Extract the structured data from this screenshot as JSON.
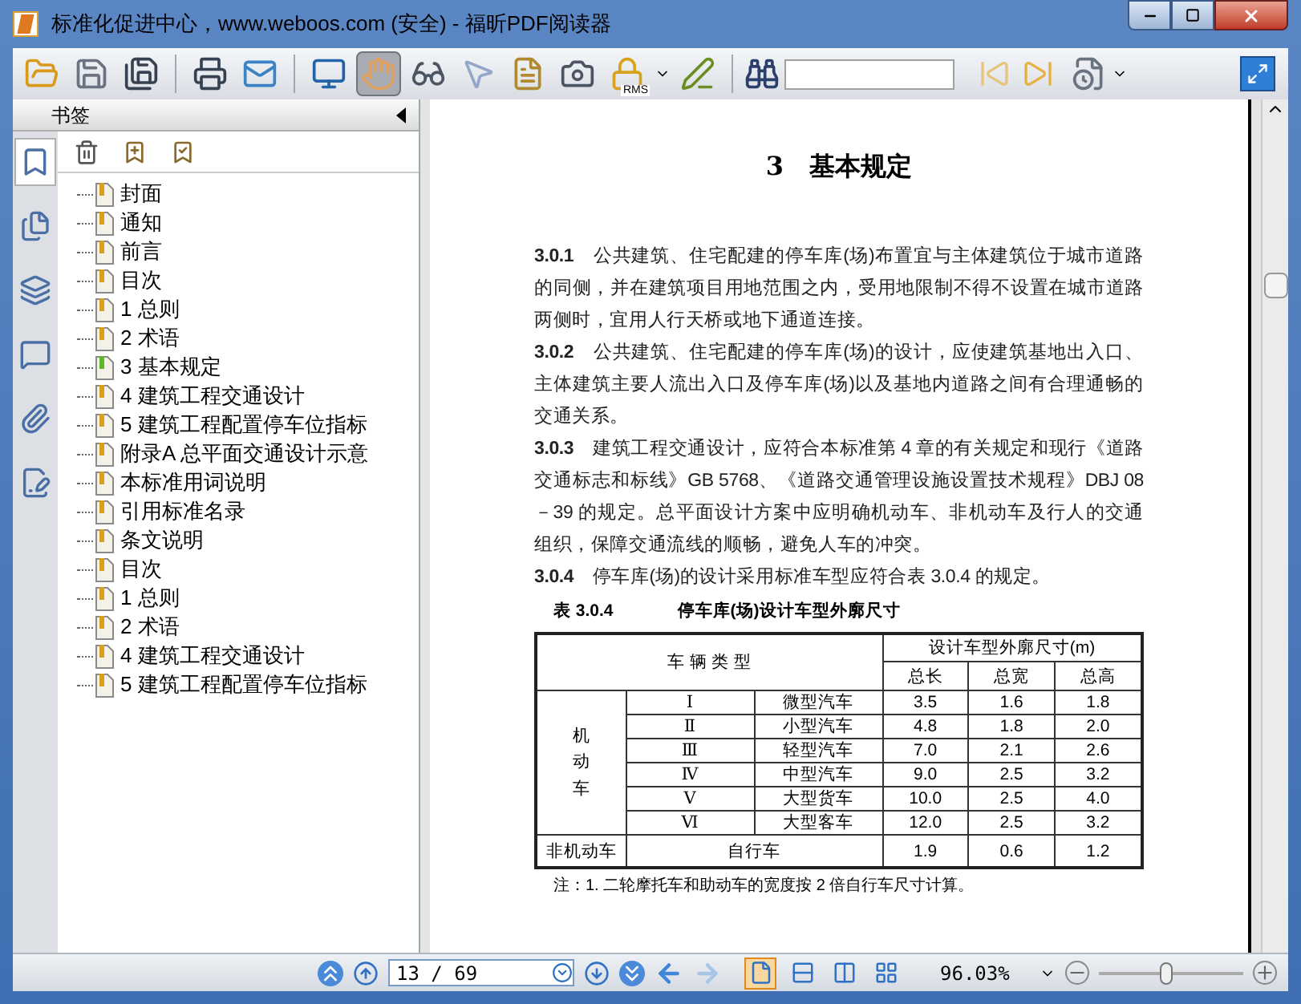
{
  "window": {
    "title": "标准化促进中心，www.weboos.com (安全) - 福昕PDF阅读器"
  },
  "toolbar": {
    "tools": [
      {
        "kind": "open",
        "selected": false
      },
      {
        "kind": "save",
        "selected": false
      },
      {
        "kind": "save_as",
        "selected": false
      },
      {
        "kind": "print",
        "selected": false
      },
      {
        "kind": "email",
        "selected": false
      },
      {
        "kind": "fullscreen",
        "selected": false
      },
      {
        "kind": "hand",
        "selected": true
      },
      {
        "kind": "zoom",
        "selected": false
      },
      {
        "kind": "select",
        "selected": false
      },
      {
        "kind": "text",
        "selected": false
      },
      {
        "kind": "snapshot",
        "selected": false
      },
      {
        "kind": "rms",
        "selected": false,
        "label": "RMS"
      },
      {
        "kind": "sign",
        "selected": false
      }
    ]
  },
  "sidebar": {
    "title": "书签",
    "tabs": [
      {
        "kind": "bookmarks",
        "selected": true
      },
      {
        "kind": "pages",
        "selected": false
      },
      {
        "kind": "layers",
        "selected": false
      },
      {
        "kind": "comments",
        "selected": false
      },
      {
        "kind": "attachments",
        "selected": false
      },
      {
        "kind": "signatures",
        "selected": false
      }
    ],
    "items": [
      {
        "label": "封面",
        "selected": false
      },
      {
        "label": "通知",
        "selected": false
      },
      {
        "label": "前言",
        "selected": false
      },
      {
        "label": "目次",
        "selected": false
      },
      {
        "label": "1 总则",
        "selected": false
      },
      {
        "label": "2 术语",
        "selected": false
      },
      {
        "label": "3 基本规定",
        "selected": true
      },
      {
        "label": "4 建筑工程交通设计",
        "selected": false
      },
      {
        "label": "5 建筑工程配置停车位指标",
        "selected": false
      },
      {
        "label": "附录A 总平面交通设计示意",
        "selected": false
      },
      {
        "label": "本标准用词说明",
        "selected": false
      },
      {
        "label": "引用标准名录",
        "selected": false
      },
      {
        "label": "条文说明",
        "selected": false
      },
      {
        "label": "目次",
        "selected": false
      },
      {
        "label": "1 总则",
        "selected": false
      },
      {
        "label": "2 术语",
        "selected": false
      },
      {
        "label": "4 建筑工程交通设计",
        "selected": false
      },
      {
        "label": "5 建筑工程配置停车位指标",
        "selected": false
      }
    ]
  },
  "document": {
    "heading": "3　基本规定",
    "paragraphs": [
      "**3.0.1**　公共建筑、住宅配建的停车库(场)布置宜与主体建筑位于城市道路的同侧，并在建筑项目用地范围之内，受用地限制不得不设置在城市道路两侧时，宜用人行天桥或地下通道连接。",
      "**3.0.2**　公共建筑、住宅配建的停车库(场)的设计，应使建筑基地出入口、主体建筑主要人流出入口及停车库(场)以及基地内道路之间有合理通畅的交通关系。",
      "**3.0.3**　建筑工程交通设计，应符合本标准第 4 章的有关规定和现行《道路交通标志和标线》GB 5768、《道路交通管理设施设置技术规程》DBJ 08－39 的规定。总平面设计方案中应明确机动车、非机动车及行人的交通组织，保障交通流线的顺畅，避免人车的冲突。",
      "**3.0.4**　停车库(场)的设计采用标准车型应符合表 3.0.4 的规定。"
    ],
    "table": {
      "number": "表 3.0.4",
      "caption": "停车库(场)设计车型外廓尺寸",
      "type_header": "车 辆 类 型",
      "size_header": "设计车型外廓尺寸(m)",
      "size_columns": [
        "总长",
        "总宽",
        "总高"
      ],
      "motor_group": "机动车",
      "motor_rows": [
        {
          "class": "Ⅰ",
          "name": "微型汽车",
          "values": [
            "3.5",
            "1.6",
            "1.8"
          ]
        },
        {
          "class": "Ⅱ",
          "name": "小型汽车",
          "values": [
            "4.8",
            "1.8",
            "2.0"
          ]
        },
        {
          "class": "Ⅲ",
          "name": "轻型汽车",
          "values": [
            "7.0",
            "2.1",
            "2.6"
          ]
        },
        {
          "class": "Ⅳ",
          "name": "中型汽车",
          "values": [
            "9.0",
            "2.5",
            "3.2"
          ]
        },
        {
          "class": "Ⅴ",
          "name": "大型货车",
          "values": [
            "10.0",
            "2.5",
            "4.0"
          ]
        },
        {
          "class": "Ⅵ",
          "name": "大型客车",
          "values": [
            "12.0",
            "2.5",
            "3.2"
          ]
        }
      ],
      "other_row": {
        "group": "非机动车",
        "name": "自行车",
        "values": [
          "1.9",
          "0.6",
          "1.2"
        ]
      }
    },
    "note": "注：1. 二轮摩托车和助动车的宽度按 2 倍自行车尺寸计算。"
  },
  "status_bar": {
    "page": "13 / 69",
    "views": [
      {
        "kind": "single",
        "selected": true
      },
      {
        "kind": "continuous",
        "selected": false
      },
      {
        "kind": "facing",
        "selected": false
      },
      {
        "kind": "continuous_facing",
        "selected": false
      }
    ],
    "zoom": "96.03%",
    "zoom_slider": {
      "level": 0.47
    }
  }
}
